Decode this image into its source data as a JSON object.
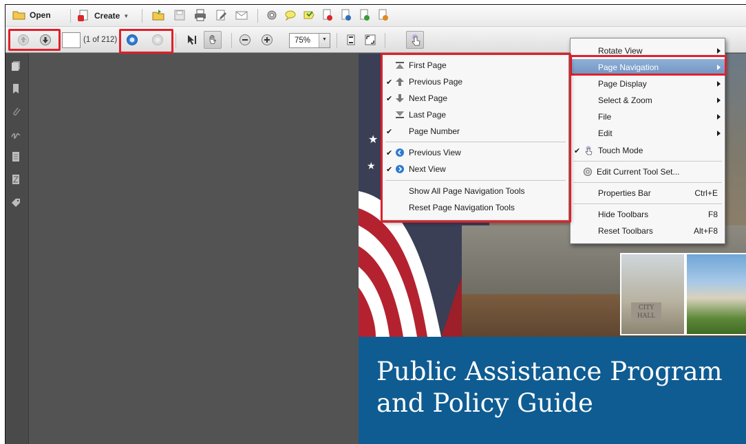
{
  "toolbar": {
    "open_label": "Open",
    "create_label": "Create",
    "page_number_value": "",
    "page_count": "(1 of 212)",
    "zoom_value": "75%"
  },
  "context_menu": {
    "items": [
      {
        "label": "Rotate View",
        "submenu": true
      },
      {
        "label": "Page Navigation",
        "submenu": true,
        "highlighted": true
      },
      {
        "label": "Page Display",
        "submenu": true
      },
      {
        "label": "Select & Zoom",
        "submenu": true
      },
      {
        "label": "File",
        "submenu": true
      },
      {
        "label": "Edit",
        "submenu": true
      },
      {
        "label": "Touch Mode",
        "checked": true,
        "icon": "hand-touch-icon"
      },
      {
        "label": "Edit Current Tool Set...",
        "icon": "gear-icon"
      },
      {
        "label": "Properties Bar",
        "shortcut": "Ctrl+E"
      },
      {
        "label": "Hide Toolbars",
        "shortcut": "F8"
      },
      {
        "label": "Reset Toolbars",
        "shortcut": "Alt+F8"
      }
    ]
  },
  "submenu": {
    "items": [
      {
        "label": "First Page",
        "icon": "first-page-icon",
        "checked": false
      },
      {
        "label": "Previous Page",
        "icon": "arrow-up-icon",
        "checked": true
      },
      {
        "label": "Next Page",
        "icon": "arrow-down-icon",
        "checked": true
      },
      {
        "label": "Last Page",
        "icon": "last-page-icon",
        "checked": false
      },
      {
        "label": "Page Number",
        "checked": true
      },
      {
        "label": "Previous View",
        "icon": "previous-view-icon",
        "checked": true
      },
      {
        "label": "Next View",
        "icon": "next-view-icon",
        "checked": true
      },
      {
        "label": "Show All Page Navigation Tools"
      },
      {
        "label": "Reset Page Navigation Tools"
      }
    ]
  },
  "document": {
    "title_line1": "Public Assistance Program",
    "title_line2": "and Policy Guide",
    "sign_text": "CITY HALL"
  },
  "colors": {
    "highlight_red": "#e0202a",
    "banner_blue": "#0f5c92",
    "menu_highlight": "#7c9fca"
  }
}
